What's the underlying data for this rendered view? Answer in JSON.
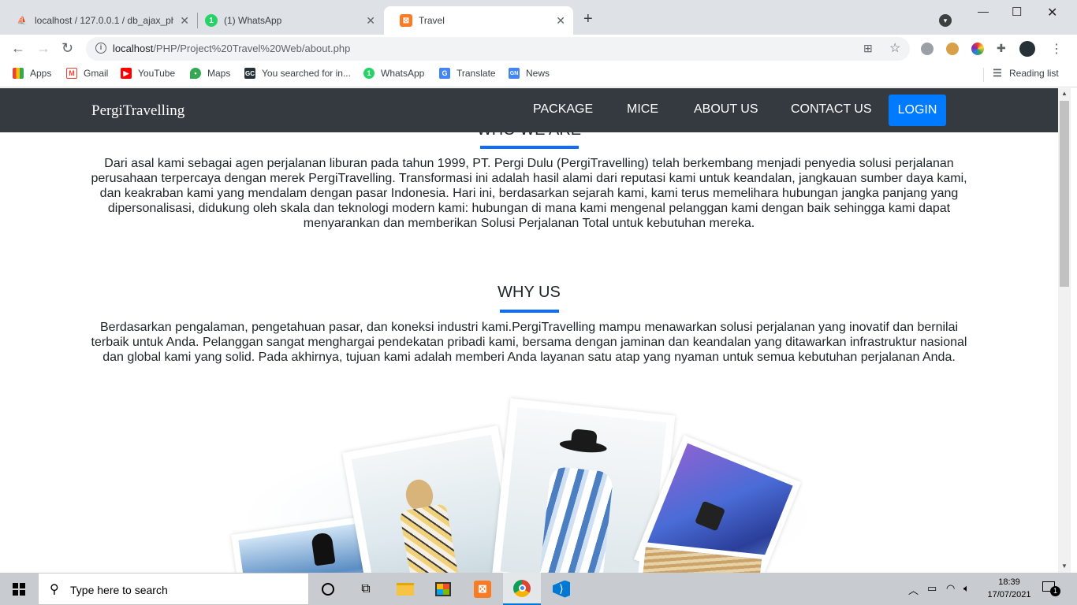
{
  "browser": {
    "tabs": [
      {
        "title": "localhost / 127.0.0.1 / db_ajax_ph",
        "favicon": "phpmyadmin-icon"
      },
      {
        "title": "(1) WhatsApp",
        "favicon": "whatsapp-icon",
        "badge": "1"
      },
      {
        "title": "Travel",
        "favicon": "xampp-icon",
        "active": true
      }
    ],
    "new_tab": "+",
    "url_host": "localhost",
    "url_path": "/PHP/Project%20Travel%20Web/about.php",
    "bookmarks": [
      {
        "label": "Apps",
        "icon": "apps-grid-icon"
      },
      {
        "label": "Gmail",
        "icon": "gmail-icon"
      },
      {
        "label": "YouTube",
        "icon": "youtube-icon"
      },
      {
        "label": "Maps",
        "icon": "maps-icon"
      },
      {
        "label": "You searched for in...",
        "icon": "gc-icon"
      },
      {
        "label": "WhatsApp",
        "icon": "whatsapp-icon"
      },
      {
        "label": "Translate",
        "icon": "translate-icon"
      },
      {
        "label": "News",
        "icon": "news-icon"
      }
    ],
    "reading_list": "Reading list"
  },
  "site": {
    "brand": "PergiTravelling",
    "nav": [
      "PACKAGE",
      "MICE",
      "ABOUT US",
      "CONTACT US"
    ],
    "login": "LOGIN",
    "who_title": "WHO WE ARE",
    "who_text": "Dari asal kami sebagai agen perjalanan liburan pada tahun 1999, PT. Pergi Dulu (PergiTravelling) telah berkembang menjadi penyedia solusi perjalanan perusahaan terpercaya dengan merek PergiTravelling. Transformasi ini adalah hasil alami dari reputasi kami untuk keandalan, jangkauan sumber daya kami, dan keakraban kami yang mendalam dengan pasar Indonesia. Hari ini, berdasarkan sejarah kami, kami terus memelihara hubungan jangka panjang yang dipersonalisasi, didukung oleh skala dan teknologi modern kami: hubungan di mana kami mengenal pelanggan kami dengan baik sehingga kami dapat menyarankan dan memberikan Solusi Perjalanan Total untuk kebutuhan mereka.",
    "why_title": "WHY US",
    "why_text": "Berdasarkan pengalaman, pengetahuan pasar, dan koneksi industri kami.PergiTravelling mampu menawarkan solusi perjalanan yang inovatif dan bernilai terbaik untuk Anda. Pelanggan sangat menghargai pendekatan pribadi kami, bersama dengan jaminan dan keandalan yang ditawarkan infrastruktur nasional dan global kami yang solid. Pada akhirnya, tujuan kami adalah memberi Anda layanan satu atap yang nyaman untuk semua kebutuhan perjalanan Anda."
  },
  "taskbar": {
    "search_placeholder": "Type here to search",
    "time": "18:39",
    "date": "17/07/2021",
    "notification_count": "1"
  },
  "colors": {
    "navbar": "#343a40",
    "accent": "#007bff",
    "underline": "#0d6efd"
  }
}
